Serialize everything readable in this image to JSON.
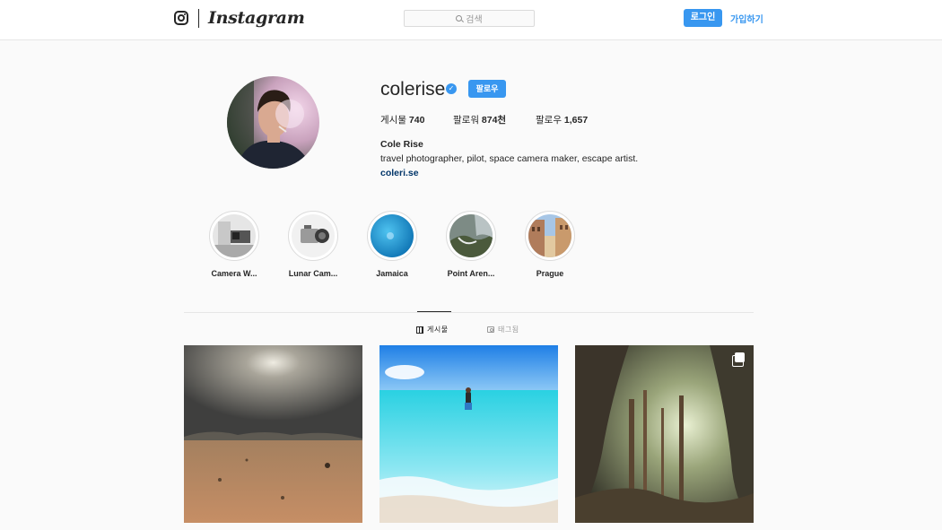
{
  "header": {
    "logo_text": "Instagram",
    "search_placeholder": "검색",
    "login_label": "로그인",
    "signup_label": "가입하기"
  },
  "profile": {
    "username": "colerise",
    "verified": true,
    "follow_label": "팔로우",
    "stats": {
      "posts_label": "게시물",
      "posts_value": "740",
      "followers_label": "팔로워",
      "followers_value": "874천",
      "following_label": "팔로우",
      "following_value": "1,657"
    },
    "full_name": "Cole Rise",
    "bio": "travel photographer, pilot, space camera maker, escape artist.",
    "link": "coleri.se"
  },
  "highlights": [
    {
      "label": "Camera W..."
    },
    {
      "label": "Lunar Cam..."
    },
    {
      "label": "Jamaica"
    },
    {
      "label": "Point Aren..."
    },
    {
      "label": "Prague"
    }
  ],
  "tabs": [
    {
      "label": "게시물",
      "active": true,
      "icon": "grid-icon"
    },
    {
      "label": "태그됨",
      "active": false,
      "icon": "tagged-icon"
    }
  ],
  "posts": [
    {
      "alt": "",
      "multiple": false
    },
    {
      "alt": "",
      "multiple": false
    },
    {
      "alt": "",
      "multiple": true
    }
  ],
  "colors": {
    "accent": "#3897f0",
    "link": "#003569",
    "background": "#fafafa"
  }
}
